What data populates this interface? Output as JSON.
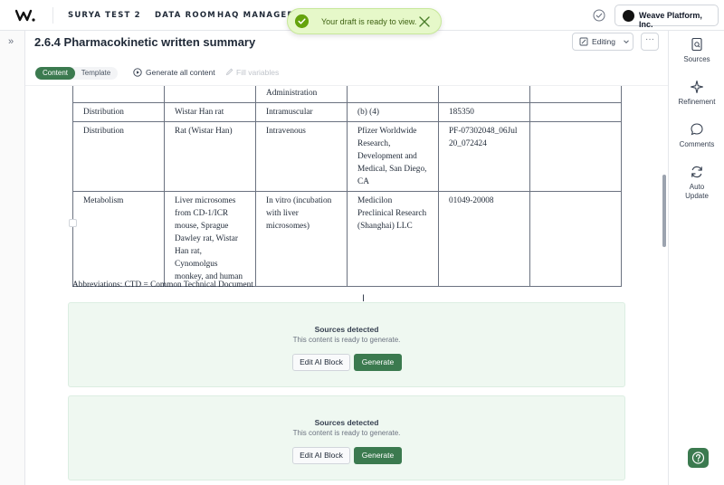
{
  "nav": {
    "items": [
      "SURYA TEST 2",
      "DATA ROOM",
      "HAQ MANAGER"
    ],
    "org_name": "Weave Platform, Inc."
  },
  "toast": {
    "message": "Your draft is ready to view."
  },
  "document": {
    "title": "2.6.4 Pharmacokinetic written summary",
    "mode_label": "Editing",
    "more_label": "···"
  },
  "toolbar": {
    "tabs": [
      "Content",
      "Template"
    ],
    "generate_all": "Generate all content",
    "fill_variables": "Fill variables"
  },
  "table": {
    "rows": [
      [
        "",
        "",
        "Administration",
        "",
        "",
        ""
      ],
      [
        "Distribution",
        "Wistar Han rat",
        "Intramuscular",
        "(b) (4)",
        "185350",
        ""
      ],
      [
        "Distribution",
        "Rat (Wistar Han)",
        "Intravenous",
        "Pfizer Worldwide Research, Development and Medical, San Diego, CA",
        "PF-07302048_06Jul20_072424",
        ""
      ],
      [
        "Metabolism",
        "Liver microsomes from CD-1/ICR mouse, Sprague Dawley rat, Wistar Han rat, Cynomolgus monkey, and human",
        "In vitro (incubation with liver microsomes)",
        "Medicilon Preclinical Research (Shanghai) LLC",
        "01049-20008",
        ""
      ]
    ],
    "abbreviations": "Abbreviations: CTD = Common Technical Document"
  },
  "ai_blocks": [
    {
      "title": "Sources detected",
      "subtitle": "This content is ready to generate.",
      "edit_label": "Edit AI Block",
      "generate_label": "Generate"
    },
    {
      "title": "Sources detected",
      "subtitle": "This content is ready to generate.",
      "edit_label": "Edit AI Block",
      "generate_label": "Generate"
    }
  ],
  "right_panel": {
    "items": [
      "Sources",
      "Refinement",
      "Comments",
      "Auto Update"
    ]
  },
  "colors": {
    "accent_green": "#3b7a4f",
    "toast_bg": "#e6f8c9",
    "ai_block_bg": "#eff8f1"
  },
  "icons": [
    "weave-logo-icon",
    "check-circle-icon",
    "close-icon",
    "double-chevron-right-icon",
    "pencil-icon",
    "chevron-down-icon",
    "sparkle-icon",
    "chat-icon",
    "refresh-icon",
    "help-icon",
    "text-cursor-icon"
  ]
}
